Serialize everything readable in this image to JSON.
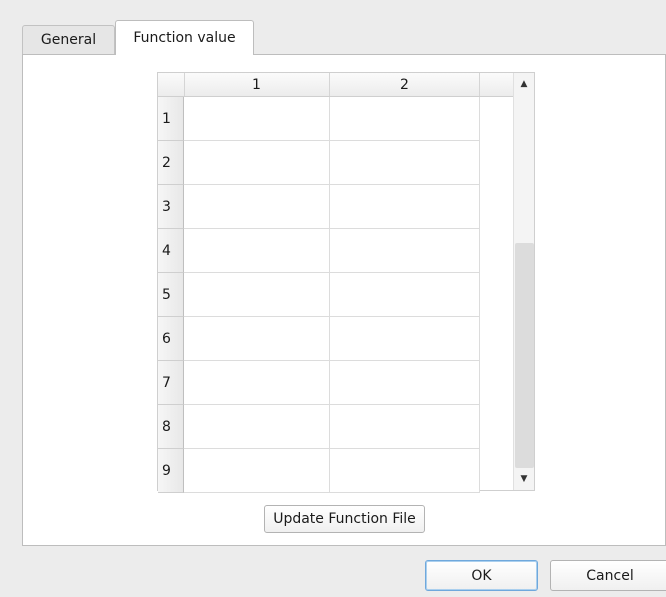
{
  "tabs": [
    {
      "label": "General",
      "active": false
    },
    {
      "label": "Function value",
      "active": true
    }
  ],
  "table": {
    "columns": [
      "1",
      "2"
    ],
    "rows": [
      "1",
      "2",
      "3",
      "4",
      "5",
      "6",
      "7",
      "8",
      "9"
    ],
    "cells": [
      [
        "",
        ""
      ],
      [
        "",
        ""
      ],
      [
        "",
        ""
      ],
      [
        "",
        ""
      ],
      [
        "",
        ""
      ],
      [
        "",
        ""
      ],
      [
        "",
        ""
      ],
      [
        "",
        ""
      ],
      [
        "",
        ""
      ]
    ]
  },
  "scrollbar": {
    "up_icon": "triangle-up",
    "down_icon": "triangle-down"
  },
  "buttons": {
    "update": "Update Function File",
    "ok": "OK",
    "cancel": "Cancel"
  }
}
